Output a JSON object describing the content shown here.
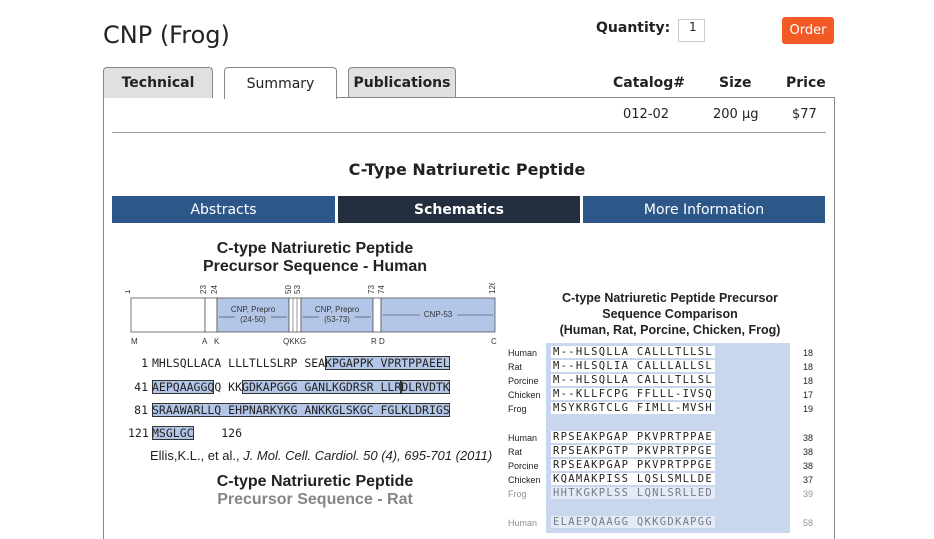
{
  "product": {
    "title": "CNP (Frog)"
  },
  "order": {
    "quantity_label": "Quantity:",
    "quantity_value": "1",
    "order_label": "Order"
  },
  "tabs": {
    "technical": "Technical",
    "summary": "Summary",
    "publications": "Publications"
  },
  "catalog": {
    "headers": {
      "catalog": "Catalog#",
      "size": "Size",
      "price": "Price"
    },
    "row": {
      "catalog": "012-02",
      "size": "200 µg",
      "price": "$77"
    }
  },
  "heading": "C-Type Natriuretic Peptide",
  "subtabs": {
    "abstracts": "Abstracts",
    "schematics": "Schematics",
    "more": "More Information"
  },
  "figure_left": {
    "title_line1": "C-type Natriuretic Peptide",
    "title_line2": "Precursor Sequence - Human",
    "bar_numbers": [
      "1",
      "23",
      "24",
      "50",
      "53",
      "73",
      "74",
      "126"
    ],
    "bar_letters": [
      "M",
      "A",
      "K",
      "QKKG",
      "R",
      "D",
      "C"
    ],
    "segments": {
      "seg1": "CNP, Prepro",
      "seg1b": "(24-50)",
      "seg2": "CNP, Prepro",
      "seg2b": "(53-73)",
      "seg3": "CNP-53"
    },
    "sequence": {
      "l1_num": "1",
      "l1_a": "MHLSQLLACA LLLTLLSLRP SEA",
      "l1_b": "KPGAPPK VPRTPPAEEL",
      "l2_num": "41",
      "l2_a": "AEPQAAGGQ",
      "l2_b": "Q KK",
      "l2_c": "GDKAPGGG GANLKGDRSR LLR",
      "l2_d": "DLRVDTK",
      "l3_num": "81",
      "l3_a": "SRAAWARLLQ EHPNARKYKG ANKKGLSKGC FGLKLDRIGS",
      "l4_num": "121",
      "l4_a": "MSGLGC",
      "l4_end": "126"
    },
    "citation_authors": "Ellis,K.L., et al., ",
    "citation_journal": "J. Mol. Cell. Cardiol. 50 (4), 695-701 (2011)",
    "title2_line1": "C-type Natriuretic Peptide",
    "title2_line2": "Precursor Sequence - Rat"
  },
  "figure_right": {
    "title_line1": "C-type Natriuretic Peptide Precursor",
    "title_line2": "Sequence Comparison",
    "title_line3": "(Human, Rat, Porcine, Chicken, Frog)",
    "block1": [
      {
        "species": "Human",
        "seq": "M--HLSQLLA CALLLTLLSL",
        "num": "18"
      },
      {
        "species": "Rat",
        "seq": "M--HLSQLIA CALLLALLSL",
        "num": "18"
      },
      {
        "species": "Porcine",
        "seq": "M--HLSQLLA CALLLTLLSL",
        "num": "18"
      },
      {
        "species": "Chicken",
        "seq": "M--KLLFCPG FFLLL-IVSQ",
        "num": "17"
      },
      {
        "species": "Frog",
        "seq": "MSYKRGTCLG FIMLL-MVSH",
        "num": "19"
      }
    ],
    "block2": [
      {
        "species": "Human",
        "seq": "RPSEAKPGAP PKVPRTPPAE",
        "num": "38"
      },
      {
        "species": "Rat",
        "seq": "RPSEAKPGTP PKVPRTPPGE",
        "num": "38"
      },
      {
        "species": "Porcine",
        "seq": "RPSEAKPGAP PKVPRTPPGE",
        "num": "38"
      },
      {
        "species": "Chicken",
        "seq": "KQAMAKPISS LQSLSMLLDE",
        "num": "37"
      },
      {
        "species": "Frog",
        "seq": "HHTKGKPLSS LQNLSRLLED",
        "num": "39"
      }
    ],
    "block3": [
      {
        "species": "Human",
        "seq": "ELAEPQAAGG QKKGDKAPGG",
        "num": "58"
      }
    ]
  }
}
